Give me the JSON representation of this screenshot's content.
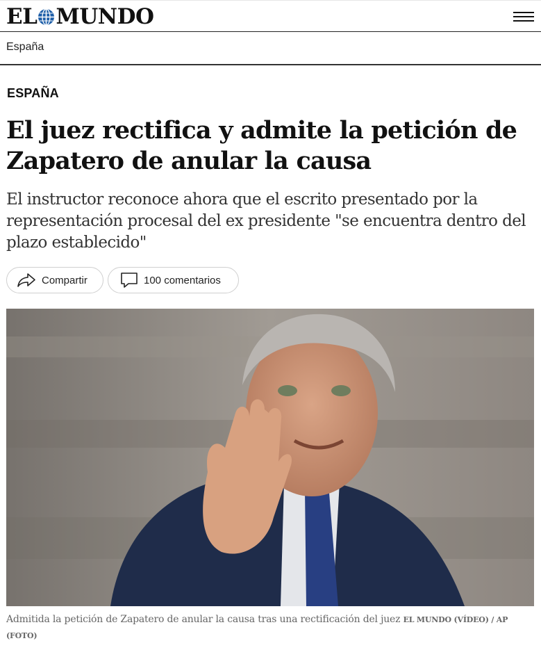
{
  "header": {
    "logo_left": "EL",
    "logo_right": "MUNDO",
    "menu_icon": "hamburger-menu-icon"
  },
  "section_bar": {
    "label": "España"
  },
  "article": {
    "kicker": "ESPAÑA",
    "headline": "El juez rectifica y admite la petición de Zapatero de anular la causa",
    "standfirst": "El instructor reconoce ahora que el escrito presentado por la representación procesal del ex presidente \"se encuentra dentro del plazo establecido\"",
    "share_label": "Compartir",
    "comments_label": "100 comentarios",
    "share_icon": "share-arrow-icon",
    "comments_icon": "comment-bubble-icon"
  },
  "media": {
    "caption": "Admitida la petición de Zapatero de anular la causa tras una rectificación del juez",
    "credit": "EL MUNDO (VÍDEO) / AP (FOTO)"
  },
  "colors": {
    "brand_blue": "#1d5ea8",
    "text_dark": "#111111",
    "caption_grey": "#666666"
  }
}
